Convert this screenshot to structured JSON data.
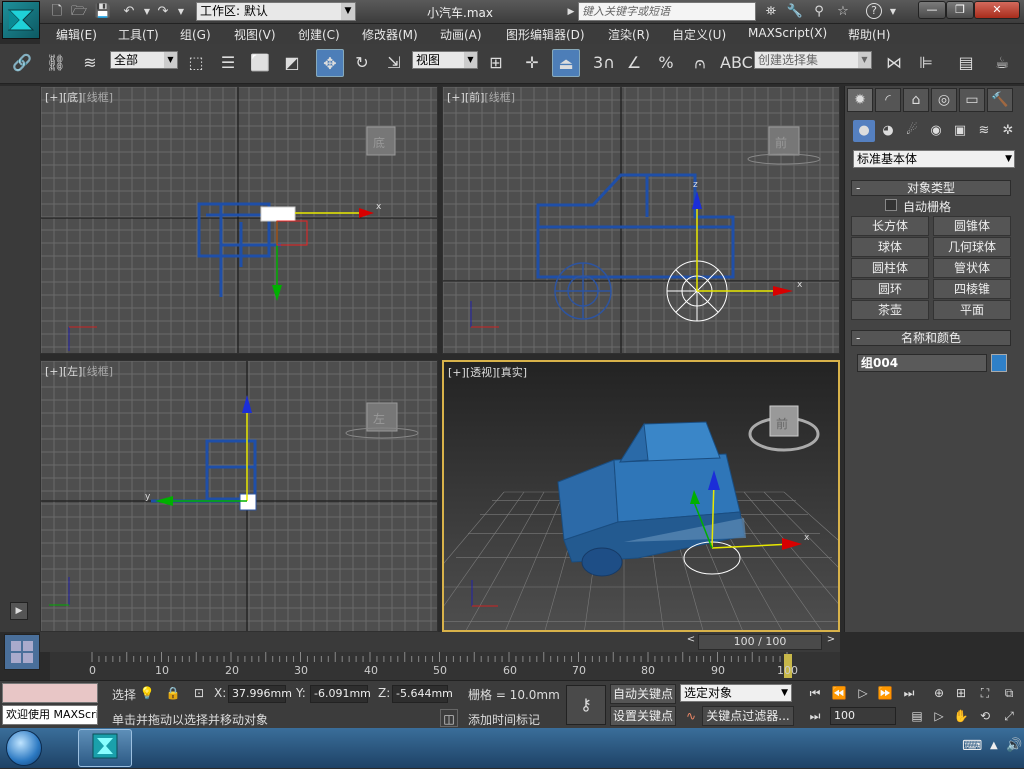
{
  "app": {
    "window_title": "小汽车.max",
    "workspace_label": "工作区: 默认",
    "search_placeholder": "键入关键字或短语"
  },
  "menu": [
    "编辑(E)",
    "工具(T)",
    "组(G)",
    "视图(V)",
    "创建(C)",
    "修改器(M)",
    "动画(A)",
    "图形编辑器(D)",
    "渲染(R)",
    "自定义(U)",
    "MAXScript(X)",
    "帮助(H)"
  ],
  "toolbar": {
    "selection_filter": "全部",
    "ref_coord": "视图",
    "named_selection": "创建选择集",
    "snap_value": "3"
  },
  "viewports": [
    {
      "id": "bottom",
      "plus": "[+]",
      "view": "[底]",
      "shading": "[线框]",
      "cube": "底"
    },
    {
      "id": "front",
      "plus": "[+]",
      "view": "[前]",
      "shading": "[线框]",
      "cube": "前"
    },
    {
      "id": "left",
      "plus": "[+]",
      "view": "[左]",
      "shading": "[线框]",
      "cube": "左"
    },
    {
      "id": "persp",
      "plus": "[+]",
      "view": "[透视]",
      "shading": "[真实]",
      "cube": "前"
    }
  ],
  "axis_labels": {
    "x": "x",
    "y": "y",
    "z": "z"
  },
  "command_panel": {
    "category": "标准基本体",
    "object_type_title": "对象类型",
    "autogrid": "自动栅格",
    "buttons": [
      "长方体",
      "圆锥体",
      "球体",
      "几何球体",
      "圆柱体",
      "管状体",
      "圆环",
      "四棱锥",
      "茶壶",
      "平面"
    ],
    "name_color_title": "名称和颜色",
    "object_name": "组004",
    "object_color": "#2f80c8"
  },
  "timeline": {
    "frame_indicator": "100 / 100",
    "ticks": [
      "0",
      "10",
      "20",
      "30",
      "40",
      "50",
      "60",
      "70",
      "80",
      "90",
      "100"
    ]
  },
  "status": {
    "script_listener": "欢迎使用 MAXScri",
    "selection_label": "选择",
    "x_label": "X:",
    "x_value": "37.996mm",
    "y_label": "Y:",
    "y_value": "-6.091mm",
    "z_label": "Z:",
    "z_value": "-5.644mm",
    "grid": "栅格 = 10.0mm",
    "prompt": "单击并拖动以选择并移动对象",
    "add_time_tag": "添加时间标记",
    "auto_key": "自动关键点",
    "set_key": "设置关键点",
    "key_mode": "选定对象",
    "key_filters": "关键点过滤器...",
    "current_frame": "100"
  }
}
